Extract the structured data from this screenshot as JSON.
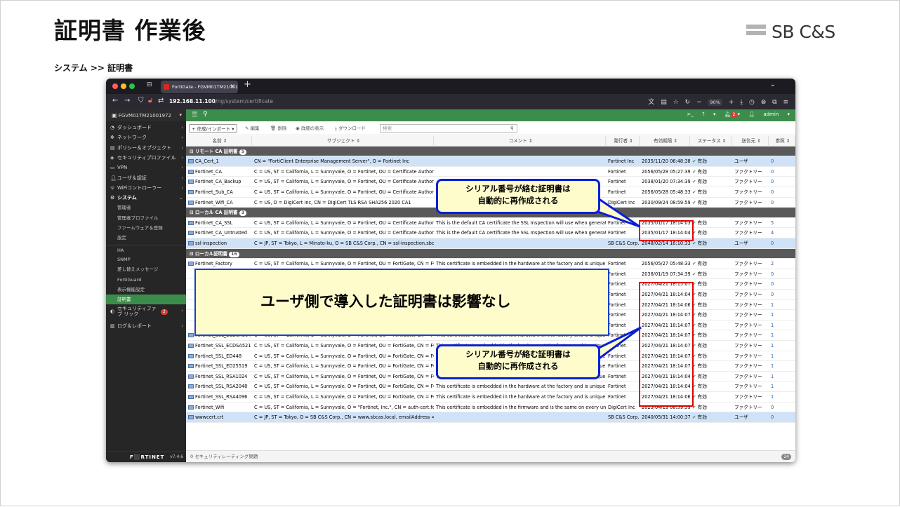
{
  "slide": {
    "title": "証明書 作業後",
    "breadcrumb": "システム >> 証明書",
    "logo_text": "SB C&S"
  },
  "browser": {
    "tab_title": "FortiGate - FGVM01TM21001972",
    "url_host": "192.168.11.100",
    "url_path": "/ng/system/certificate",
    "zoom": "90%"
  },
  "fortigate": {
    "device": "FGVM01TM21001972",
    "user": "admin",
    "notif_count": "2",
    "version": "v7.4.6",
    "brand": "F⬛RTINET"
  },
  "sidebar": [
    {
      "label": "ダッシュボード",
      "icon": "dashboard-icon",
      "chev": "›"
    },
    {
      "label": "ネットワーク",
      "icon": "network-icon",
      "chev": "›"
    },
    {
      "label": "ポリシー＆オブジェクト",
      "icon": "policy-icon",
      "chev": "›"
    },
    {
      "label": "セキュリティプロファイル",
      "icon": "security-profile-icon",
      "chev": "›"
    },
    {
      "label": "VPN",
      "icon": "vpn-icon",
      "chev": "›"
    },
    {
      "label": "ユーザ＆認証",
      "icon": "user-icon",
      "chev": "›"
    },
    {
      "label": "WiFiコントローラー",
      "icon": "wifi-icon",
      "chev": "›"
    },
    {
      "label": "システム",
      "icon": "gear-icon",
      "chev": "⌄"
    }
  ],
  "sidebar_sub": [
    "管理者",
    "管理者プロファイル",
    "ファームウェア＆登録",
    "設定",
    "HA",
    "SNMP",
    "差し替えメッセージ",
    "FortiGuard",
    "表示機能設定",
    "証明書"
  ],
  "sidebar_bottom": [
    {
      "label": "セキュリティファブ リック",
      "badge": "2"
    },
    {
      "label": "ログ＆レポート"
    }
  ],
  "toolbar": {
    "create": "+ 作成/インポート ▾",
    "edit": "✎ 編集",
    "delete": "🗑 削除",
    "details": "◉ 詳細の表示",
    "download": "⤓ ダウンロード",
    "search_placeholder": "検索"
  },
  "columns": [
    "名前 ⇕",
    "サブジェクト ⇕",
    "コメント ⇕",
    "発行者 ⇕",
    "有効期限 ⇕",
    "ステータス ⇕",
    "送信元 ⇕",
    "参照 ⇕"
  ],
  "groups": {
    "remote": "リモート CA 証明書",
    "remote_count": "5",
    "local_ca": "ローカル CA 証明書",
    "local_ca_count": "3",
    "local": "ローカル証明書",
    "local_count": "16"
  },
  "remote_rows": [
    [
      "CA_Cert_1",
      "CN = \"FortiClient Enterprise Management Server\", O = Fortinet Inc",
      "",
      "Fortinet Inc",
      "2035/11/20 06:48:38",
      "有効",
      "ユーザ",
      "0"
    ],
    [
      "Fortinet_CA",
      "C = US, ST = California, L = Sunnyvale, O = Fortinet, OU = Certificate Authority, CN ...",
      "",
      "Fortinet",
      "2056/05/28 05:27:39",
      "有効",
      "ファクトリー",
      "0"
    ],
    [
      "Fortinet_CA_Backup",
      "C = US, ST = California, L = Sunnyvale, O = Fortinet, OU = Certificate Authority, CN ...",
      "",
      "Fortinet",
      "2038/01/20 07:34:39",
      "有効",
      "ファクトリー",
      "0"
    ],
    [
      "Fortinet_Sub_CA",
      "C = US, ST = California, L = Sunnyvale, O = Fortinet, OU = Certificate Authority, CN ...",
      "",
      "Fortinet",
      "2056/05/28 05:48:33",
      "有効",
      "ファクトリー",
      "0"
    ],
    [
      "Fortinet_Wifi_CA",
      "C = US, O = DigiCert Inc, CN = DigiCert TLS RSA SHA256 2020 CA1",
      "",
      "DigiCert Inc",
      "2030/09/24 08:59:59",
      "有効",
      "ファクトリー",
      "0"
    ]
  ],
  "local_ca_rows": [
    [
      "Fortinet_CA_SSL",
      "C = US, ST = California, L = Sunnyvale, O = Fortinet, OU = Certificate Authority, CN ...",
      "This is the default CA certificate the SSL Inspection will use when generating n...",
      "Fortinet",
      "2035/01/17 18:14:03",
      "有効",
      "ファクトリー",
      "5"
    ],
    [
      "Fortinet_CA_Untrusted",
      "C = US, ST = California, L = Sunnyvale, O = Fortinet, OU = Certificate Authority, CN ...",
      "This is the default CA certificate the SSL Inspection will use when generating n...",
      "Fortinet",
      "2035/01/17 18:14:04",
      "有効",
      "ファクトリー",
      "4"
    ],
    [
      "ssl-inspection",
      "C = JP, ST = Tokyo, L = Minato-ku, O = SB C&S Corp., CN = ssl-inspection.sbcas.local,...",
      "",
      "SB C&S Corp.",
      "2048/02/14 16:10:33",
      "有効",
      "ユーザ",
      "0"
    ]
  ],
  "local_rows": [
    [
      "Fortinet_Factory",
      "C = US, ST = California, L = Sunnyvale, O = Fortinet, OU = FortiGate, CN = FGVM01...",
      "This certificate is embedded in the hardware at the factory and is unique to thi...",
      "Fortinet",
      "2056/05/27 05:48:33",
      "有効",
      "ファクトリー",
      "2"
    ],
    [
      "",
      "",
      "",
      "Fortinet",
      "2038/01/19 07:34:39",
      "有効",
      "ファクトリー",
      "0"
    ],
    [
      "",
      "",
      "",
      "Fortinet",
      "2027/04/21 18:15:07",
      "有効",
      "ファクトリー",
      "0"
    ],
    [
      "",
      "",
      "",
      "Fortinet",
      "2027/04/21 18:14:04",
      "有効",
      "ファクトリー",
      "0"
    ],
    [
      "",
      "",
      "",
      "Fortinet",
      "2027/04/21 18:14:06",
      "有効",
      "ファクトリー",
      "1"
    ],
    [
      "",
      "",
      "",
      "Fortinet",
      "2027/04/21 18:14:07",
      "有効",
      "ファクトリー",
      "1"
    ],
    [
      "",
      "",
      "",
      "Fortinet",
      "2027/04/21 18:14:07",
      "有効",
      "ファクトリー",
      "1"
    ],
    [
      "Fortinet_SSL_ECDSA384",
      "C = US, ST = California, L = Sunnyvale, O = Fortinet, OU = FortiGate, CN = FGVM01...",
      "This certificate is embedded in the hardware at the factory and is unique to thi...",
      "Fortinet",
      "2027/04/21 18:14:07",
      "有効",
      "ファクトリー",
      "1"
    ],
    [
      "Fortinet_SSL_ECDSA521",
      "C = US, ST = California, L = Sunnyvale, O = Fortinet, OU = FortiGate, CN = FGVM01...",
      "This certificate is embedded in the hardware at the factory and is unique to thi...",
      "Fortinet",
      "2027/04/21 18:14:07",
      "有効",
      "ファクトリー",
      "1"
    ],
    [
      "Fortinet_SSL_ED448",
      "C = US, ST = California, L = Sunnyvale, O = Fortinet, OU = FortiGate, CN = FGVM01...",
      "This certificate is embedded in the hardware at the factory and is unique to thi...",
      "Fortinet",
      "2027/04/21 18:14:07",
      "有効",
      "ファクトリー",
      "1"
    ],
    [
      "Fortinet_SSL_ED25519",
      "C = US, ST = California, L = Sunnyvale, O = Fortinet, OU = FortiGate, CN = FGVM01...",
      "This certificate is embedded in the hardware at the factory and is unique to thi...",
      "Fortinet",
      "2027/04/21 18:14:07",
      "有効",
      "ファクトリー",
      "1"
    ],
    [
      "Fortinet_SSL_RSA1024",
      "C = US, ST = California, L = Sunnyvale, O = Fortinet, OU = FortiGate, CN = FGVM01...",
      "This certificate is embedded in the hardware at the factory and is unique to thi...",
      "Fortinet",
      "2027/04/21 18:14:04",
      "有効",
      "ファクトリー",
      "1"
    ],
    [
      "Fortinet_SSL_RSA2048",
      "C = US, ST = California, L = Sunnyvale, O = Fortinet, OU = FortiGate, CN = FGVM01...",
      "This certificate is embedded in the hardware at the factory and is unique to thi...",
      "Fortinet",
      "2027/04/21 18:14:04",
      "有効",
      "ファクトリー",
      "1"
    ],
    [
      "Fortinet_SSL_RSA4096",
      "C = US, ST = California, L = Sunnyvale, O = Fortinet, OU = FortiGate, CN = FGVM01...",
      "This certificate is embedded in the hardware at the factory and is unique to thi...",
      "Fortinet",
      "2027/04/21 18:14:06",
      "有効",
      "ファクトリー",
      "1"
    ],
    [
      "Fortinet_Wifi",
      "C = US, ST = California, L = Sunnyvale, O = \"Fortinet, Inc.\", CN = auth-cert.fortinet.co...",
      "This certificate is embedded in the firmware and is the same on every unit (not ...",
      "DigiCert Inc",
      "2025/04/13 08:59:59",
      "有効",
      "ファクトリー",
      "0"
    ],
    [
      "wwwcert.crt",
      "C = JP, ST = Tokyo, O = SB C&S Corp., CN = www.sbcas.local, emailAddress = testma...",
      "",
      "SB C&S Corp.",
      "2040/05/31 14:00:37",
      "有効",
      "ユーザ",
      "0"
    ]
  ],
  "statusbar": {
    "text": "0  セキュリティレーティング問題",
    "count": "24"
  },
  "callouts": {
    "serial": "シリアル番号が絡む証明書は\n自動的に再作成される",
    "user_cert": "ユーザ側で導入した証明書は影響なし"
  }
}
